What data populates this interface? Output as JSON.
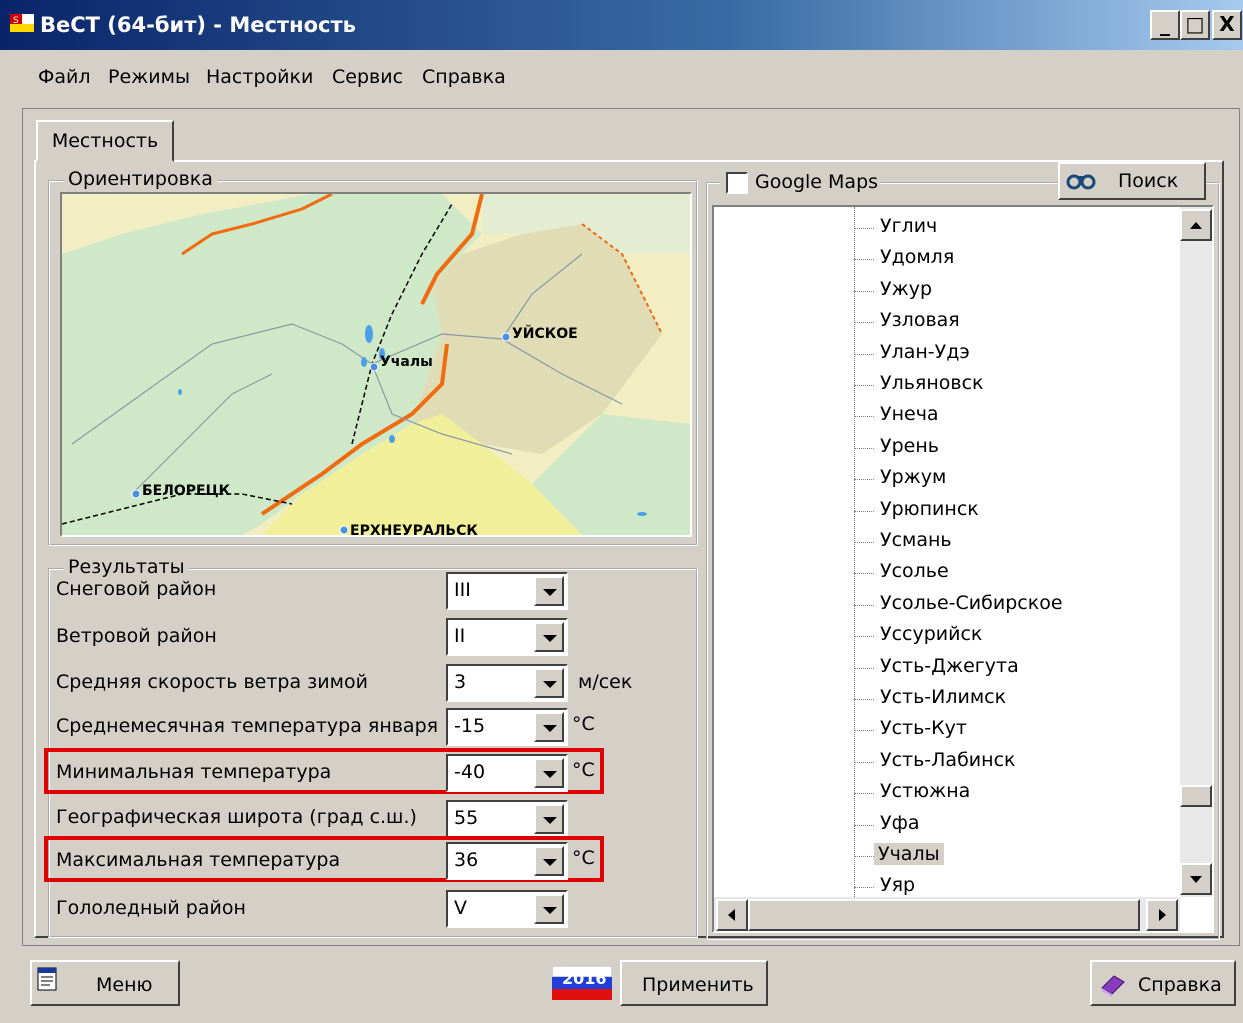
{
  "window": {
    "title": "ВеСТ (64-бит) - Местность",
    "minimize": "_",
    "maximize": "□",
    "close": "X"
  },
  "menu": [
    "Файл",
    "Режимы",
    "Настройки",
    "Сервис",
    "Справка"
  ],
  "tab": {
    "label": "Местность"
  },
  "orientation": {
    "legend": "Ориентировка",
    "map_labels": [
      "УЙСКОЕ",
      "Учалы",
      "БЕЛОРЕЦК",
      "ЕРХНЕУРАЛЬСК"
    ]
  },
  "results": {
    "legend": "Результаты",
    "rows": [
      {
        "label": "Снеговой район",
        "value": "III",
        "unit": ""
      },
      {
        "label": "Ветровой район",
        "value": "II",
        "unit": ""
      },
      {
        "label": "Средняя скорость ветра зимой",
        "value": "3",
        "unit": "м/сек"
      },
      {
        "label": "Среднемесячная температура января",
        "value": "-15",
        "unit": "°С"
      },
      {
        "label": "Минимальная температура",
        "value": "-40",
        "unit": "°С"
      },
      {
        "label": "Географическая широта (град с.ш.)",
        "value": "55",
        "unit": ""
      },
      {
        "label": "Максимальная температура",
        "value": "36",
        "unit": "°С"
      },
      {
        "label": "Гололедный район",
        "value": "V",
        "unit": ""
      }
    ]
  },
  "google_maps": {
    "label": "Google Maps",
    "checked": false
  },
  "search_button": "Поиск",
  "cities": [
    "Углич",
    "Удомля",
    "Ужур",
    "Узловая",
    "Улан-Удэ",
    "Ульяновск",
    "Унеча",
    "Урень",
    "Уржум",
    "Урюпинск",
    "Усмань",
    "Усолье",
    "Усолье-Сибирское",
    "Уссурийск",
    "Усть-Джегута",
    "Усть-Илимск",
    "Усть-Кут",
    "Усть-Лабинск",
    "Устюжна",
    "Уфа",
    "Учалы",
    "Уяр"
  ],
  "selected_city": "Учалы",
  "bottom": {
    "menu_button": "Меню",
    "year_badge": "2016",
    "apply_button": "Применить",
    "help_button": "Справка"
  },
  "colors": {
    "highlight": "#e00000",
    "titlebar": "#0a246a",
    "map_border_line": "#f06a10"
  }
}
